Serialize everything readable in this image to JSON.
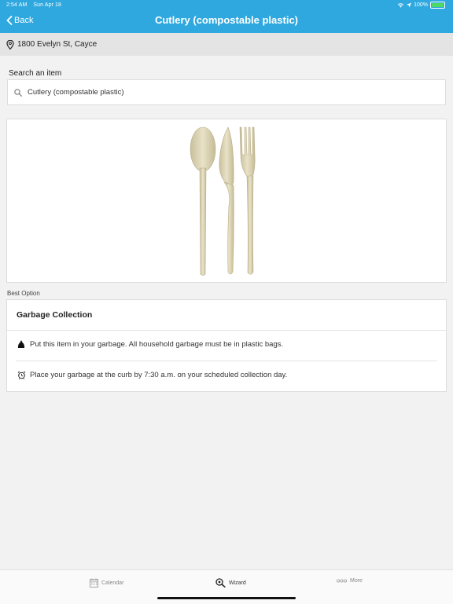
{
  "status_bar": {
    "time": "2:54 AM",
    "date": "Sun Apr 18",
    "battery": "100%"
  },
  "header": {
    "back_label": "Back",
    "title": "Cutlery (compostable plastic)",
    "color": "#2ea8df"
  },
  "location": {
    "address": "1800 Evelyn St, Cayce",
    "icon": "map-pin-icon"
  },
  "search": {
    "label": "Search an item",
    "value": "Cutlery (compostable plastic)",
    "icon": "search-icon"
  },
  "image": {
    "subject": "compostable spoon knife fork"
  },
  "best_option": {
    "label": "Best Option",
    "title": "Garbage Collection",
    "instructions": [
      {
        "icon": "garbage-bag-icon",
        "text": "Put this item in your garbage. All household garbage must be in plastic bags."
      },
      {
        "icon": "alarm-clock-icon",
        "text": "Place your garbage at the curb by 7:30 a.m. on your scheduled collection day."
      }
    ]
  },
  "tabs": [
    {
      "label": "Calendar",
      "icon": "calendar-icon",
      "active": false
    },
    {
      "label": "Wizard",
      "icon": "wizard-search-icon",
      "active": true
    },
    {
      "label": "More",
      "icon": "more-icon",
      "active": false
    }
  ]
}
